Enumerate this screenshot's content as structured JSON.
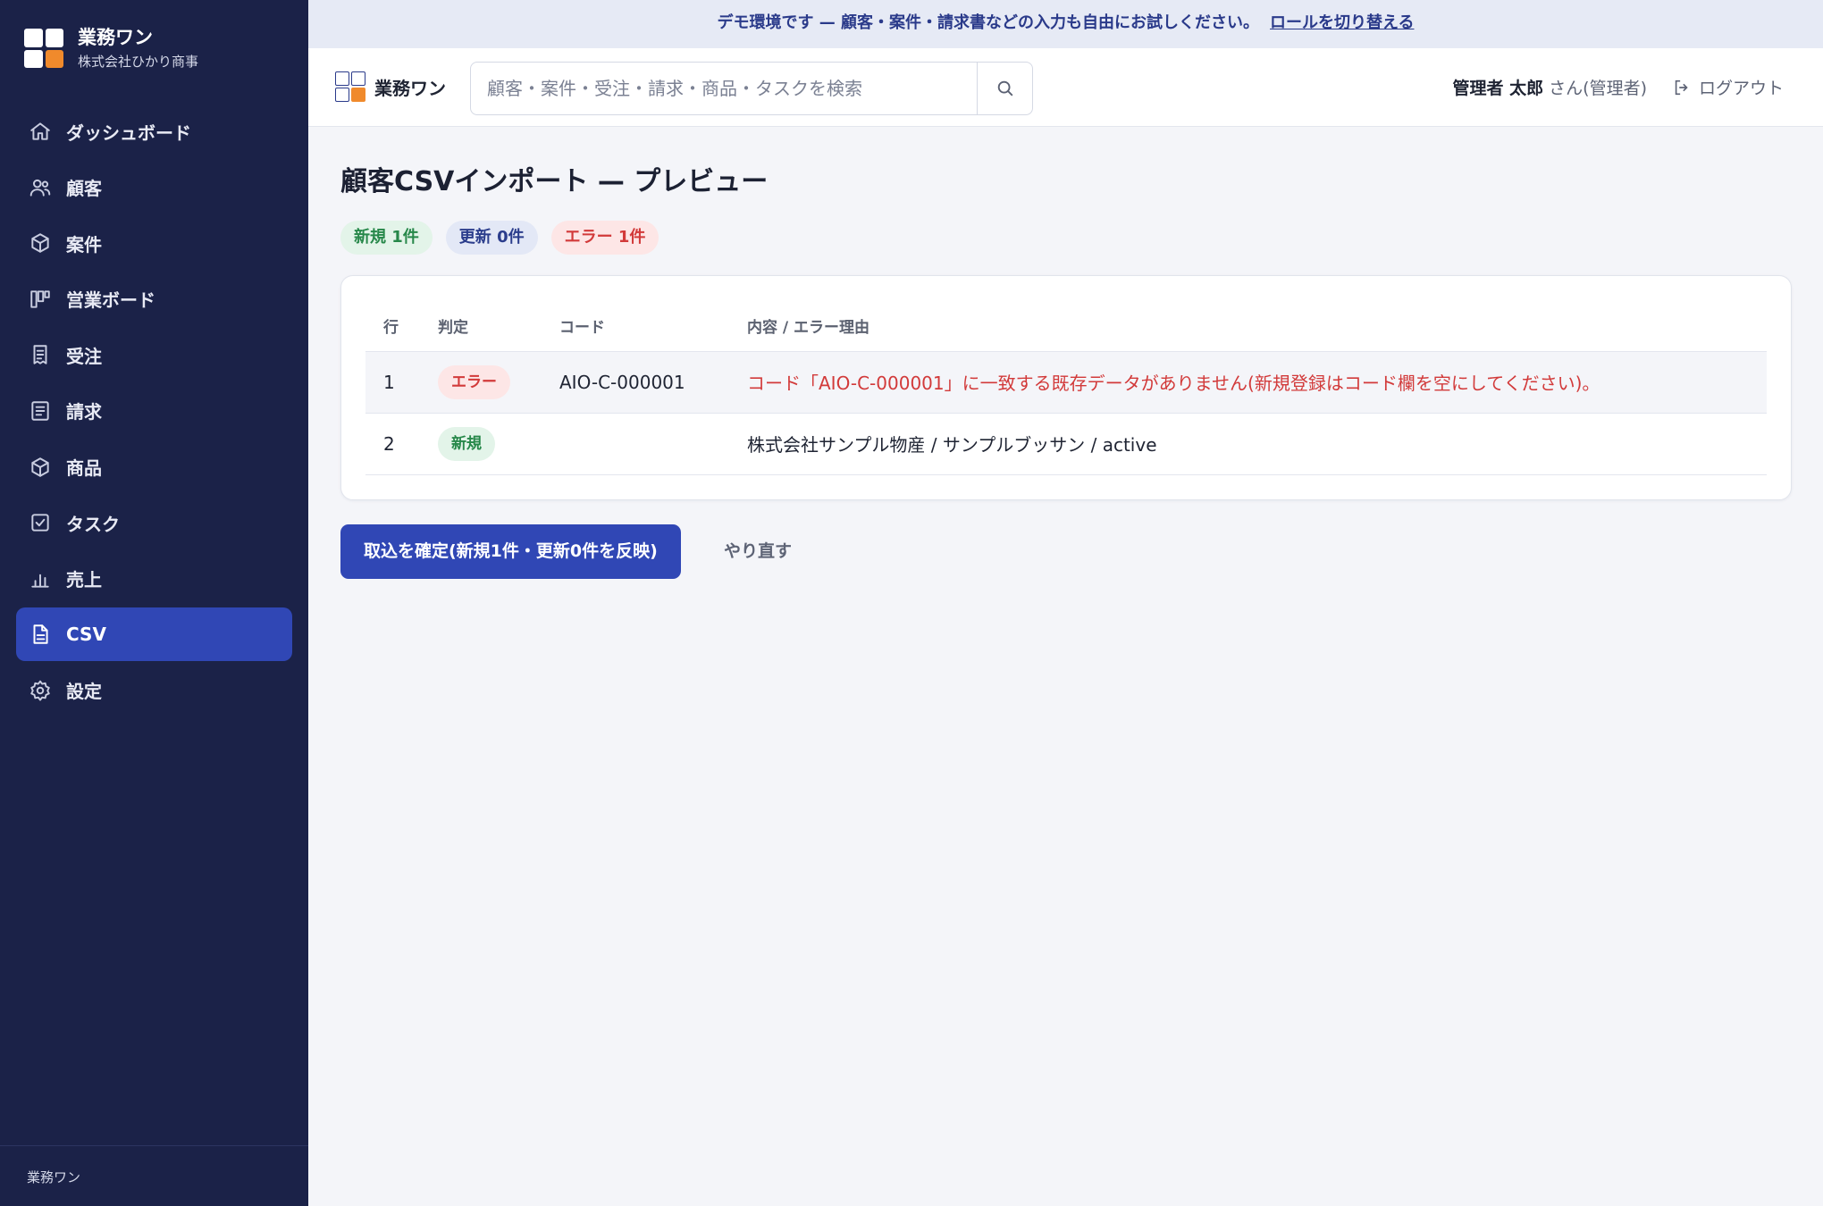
{
  "sidebar": {
    "brand_title": "業務ワン",
    "brand_sub": "株式会社ひかり商事",
    "items": [
      {
        "label": "ダッシュボード",
        "icon": "home-icon"
      },
      {
        "label": "顧客",
        "icon": "users-icon"
      },
      {
        "label": "案件",
        "icon": "cube-icon"
      },
      {
        "label": "営業ボード",
        "icon": "kanban-icon"
      },
      {
        "label": "受注",
        "icon": "receipt-icon"
      },
      {
        "label": "請求",
        "icon": "document-icon"
      },
      {
        "label": "商品",
        "icon": "cube-icon"
      },
      {
        "label": "タスク",
        "icon": "checkbox-icon"
      },
      {
        "label": "売上",
        "icon": "bar-chart-icon"
      },
      {
        "label": "CSV",
        "icon": "file-icon",
        "active": true
      },
      {
        "label": "設定",
        "icon": "gear-icon"
      }
    ],
    "footer": "業務ワン"
  },
  "banner": {
    "text": "デモ環境です — 顧客・案件・請求書などの入力も自由にお試しください。",
    "link": "ロールを切り替える"
  },
  "header": {
    "brand": "業務ワン",
    "search_placeholder": "顧客・案件・受注・請求・商品・タスクを検索",
    "user_name": "管理者 太郎",
    "user_role": "さん(管理者)",
    "logout": "ログアウト"
  },
  "main": {
    "title": "顧客CSVインポート — プレビュー",
    "badges": {
      "new": "新規 1件",
      "update": "更新 0件",
      "error": "エラー 1件"
    },
    "table": {
      "headers": [
        "行",
        "判定",
        "コード",
        "内容 / エラー理由"
      ],
      "rows": [
        {
          "row": "1",
          "status": "エラー",
          "code": "AIO-C-000001",
          "detail": "コード「AIO-C-000001」に一致する既存データがありません(新規登録はコード欄を空にしてください)。"
        },
        {
          "row": "2",
          "status": "新規",
          "code": "",
          "detail": "株式会社サンプル物産 / サンプルブッサン / active"
        }
      ]
    },
    "confirm_button": "取込を確定(新規1件・更新0件を反映)",
    "retry_button": "やり直す"
  },
  "colors": {
    "sidebar": "#1b2248",
    "accent": "#3047b5",
    "error": "#d23a3a",
    "success": "#27884a",
    "brand_orange": "#f08a2c"
  }
}
